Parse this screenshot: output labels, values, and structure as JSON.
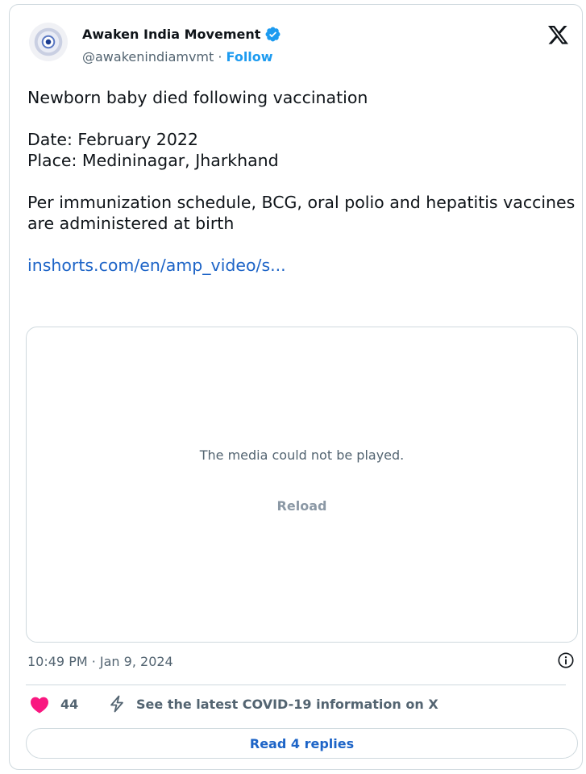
{
  "tweet": {
    "author": {
      "display_name": "Awaken India Movement",
      "handle": "@awakenindiamvmt",
      "separator": " · ",
      "follow_label": "Follow",
      "verified": true
    },
    "text": {
      "line1": "Newborn baby died following vaccination",
      "line2": "Date: February 2022",
      "line3": "Place: Medininagar, Jharkhand",
      "line4": "Per immunization schedule, BCG, oral polio and hepatitis vaccines are administered at birth",
      "link": "inshorts.com/en/amp_video/s..."
    },
    "media": {
      "message": "The media could not be played.",
      "reload_label": "Reload"
    },
    "timestamp": "10:49 PM · Jan 9, 2024",
    "likes": "44",
    "covid_info": "See the latest COVID-19 information on X",
    "read_replies": "Read 4 replies"
  },
  "colors": {
    "accent": "#1d9bf0",
    "link": "#1d64c7",
    "like": "#f91880",
    "text": "#0f1419",
    "muted": "#536471",
    "border": "#cfd9de"
  },
  "icons": {
    "brand": "x-logo-icon",
    "verified": "verified-badge-icon",
    "info": "info-icon",
    "like": "heart-icon",
    "covid": "lightning-bolt-icon"
  }
}
